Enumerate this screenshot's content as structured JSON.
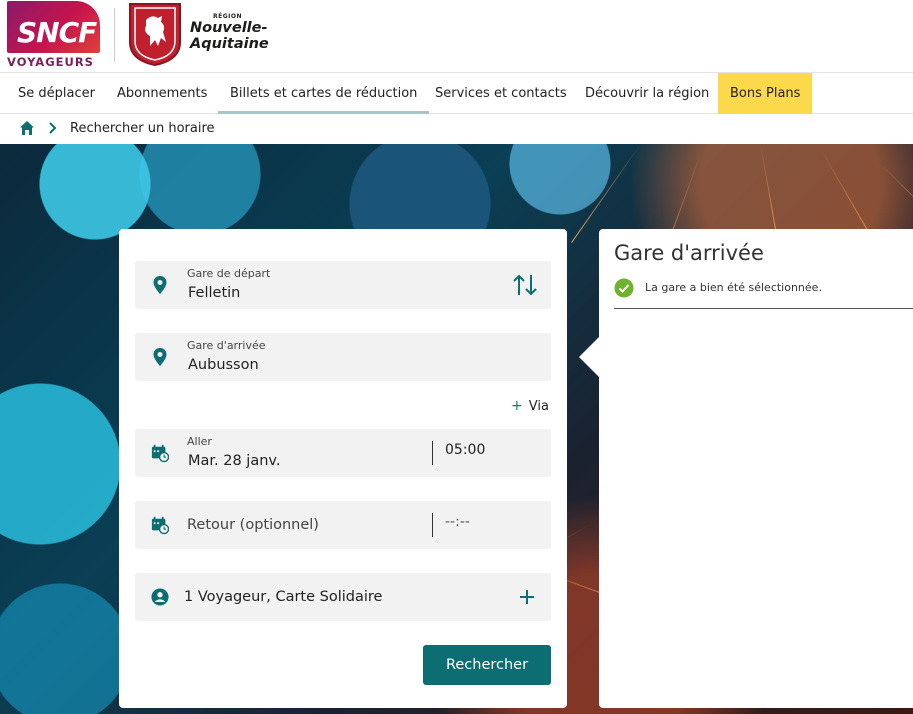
{
  "header": {
    "brand": "SNCF",
    "brand_sub": "VOYAGEURS",
    "region_prefix": "RÉGION",
    "region_line1": "Nouvelle-",
    "region_line2": "Aquitaine",
    "brand_color": "#c4144e"
  },
  "nav": {
    "items": [
      {
        "label": "Se déplacer"
      },
      {
        "label": "Abonnements"
      },
      {
        "label": "Billets et cartes de réduction"
      },
      {
        "label": "Services et contacts"
      },
      {
        "label": "Découvrir la région"
      },
      {
        "label": "Bons Plans"
      }
    ],
    "active_index": 2,
    "highlight_color": "#fcd94a"
  },
  "breadcrumb": {
    "home_icon": "home-icon",
    "current": "Rechercher un horaire"
  },
  "search": {
    "departure": {
      "label": "Gare de départ",
      "value": "Felletin"
    },
    "arrival": {
      "label": "Gare d'arrivée",
      "value": "Aubusson"
    },
    "via_label": "Via",
    "outbound": {
      "label": "Aller",
      "date": "Mar. 28 janv.",
      "time": "05:00"
    },
    "return": {
      "label": "Retour (optionnel)",
      "time": "--:--"
    },
    "passengers": "1 Voyageur, Carte Solidaire",
    "submit_label": "Rechercher",
    "accent_color": "#0c6e73"
  },
  "panel": {
    "title": "Gare d'arrivée",
    "message": "La gare a bien été sélectionnée."
  }
}
